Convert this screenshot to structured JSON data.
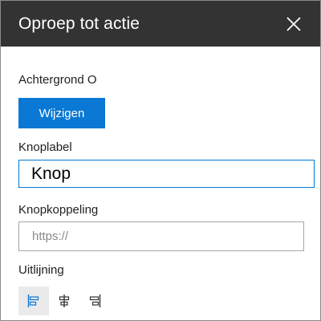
{
  "header": {
    "title": "Oproep tot actie"
  },
  "background": {
    "label": "Achtergrond O",
    "change_button": "Wijzigen"
  },
  "button_label": {
    "label": "Knoplabel",
    "value": "Knop"
  },
  "button_link": {
    "label": "Knopkoppeling",
    "placeholder": "https://"
  },
  "alignment": {
    "label": "Uitlijning",
    "options": [
      {
        "icon": "align-left-icon",
        "selected": true
      },
      {
        "icon": "align-center-icon",
        "selected": false
      },
      {
        "icon": "align-right-icon",
        "selected": false
      }
    ]
  },
  "colors": {
    "header_bg": "#333333",
    "accent": "#0a78d4",
    "input_border_focus": "#0078d4",
    "input_border": "#a6a6a6"
  }
}
